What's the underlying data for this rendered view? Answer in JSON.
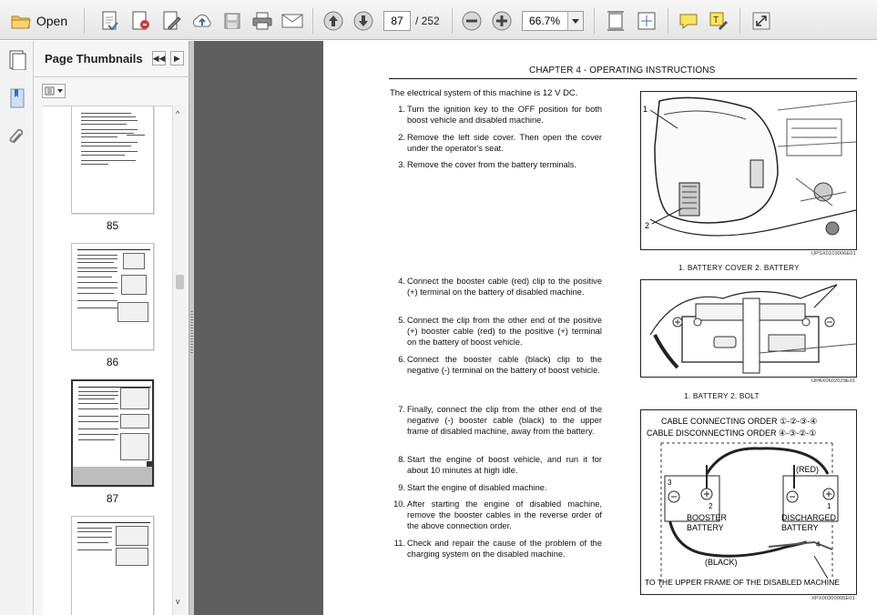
{
  "toolbar": {
    "open_label": "Open",
    "page_current": "87",
    "page_total": "/ 252",
    "zoom": "66.7%"
  },
  "panel": {
    "title": "Page Thumbnails",
    "thumbnails": [
      {
        "label": "85"
      },
      {
        "label": "86"
      },
      {
        "label": "87"
      },
      {
        "label": ""
      }
    ]
  },
  "page": {
    "chapter_header": "CHAPTER 4 - OPERATING INSTRUCTIONS",
    "intro": "The electrical system of this machine is 12 V DC.",
    "steps": [
      {
        "num": "1.",
        "text": "Turn the ignition key to the OFF position for both boost vehicle and disabled machine."
      },
      {
        "num": "2.",
        "text": "Remove the left side cover. Then open the cover under the operator's seat."
      },
      {
        "num": "3.",
        "text": "Remove the cover from the battery terminals."
      },
      {
        "num": "4.",
        "text": "Connect the booster cable (red) clip to the positive (+) terminal on the battery of disabled machine."
      },
      {
        "num": "5.",
        "text": "Connect the clip from the other end of the positive (+) booster cable (red) to the positive (+) terminal on the battery of boost vehicle."
      },
      {
        "num": "6.",
        "text": "Connect the booster cable (black) clip to the negative (-) terminal on the battery of boost vehicle."
      },
      {
        "num": "7.",
        "text": "Finally, connect the clip from the other end of the negative (-) booster cable (black) to the upper frame of disabled machine, away from the battery."
      },
      {
        "num": "8.",
        "text": "Start the engine of boost vehicle, and run it for about 10 minutes at high idle."
      },
      {
        "num": "9.",
        "text": "Start the engine of disabled machine."
      },
      {
        "num": "10.",
        "text": "After starting the engine of disabled machine, remove the booster cables in the reverse order of the above connection order."
      },
      {
        "num": "11.",
        "text": "Check and repair the cause of the problem of the charging system on the disabled machine."
      }
    ],
    "fig1": {
      "callout1": "1",
      "callout2": "2",
      "code": "UPSX0103006E01",
      "caption": "1. BATTERY COVER     2. BATTERY"
    },
    "fig2": {
      "code": "UPAX0602029E01",
      "caption": "1. BATTERY          2. BOLT"
    },
    "fig3": {
      "connect_order": "CABLE CONNECTING ORDER ①-②-③-④",
      "disconnect_order": "CABLE DISCONNECTING ORDER ④-③-②-①",
      "red": "(RED)",
      "black": "(BLACK)",
      "booster": "BOOSTER",
      "booster2": "BATTERY",
      "discharged": "DISCHARGED",
      "discharged2": "BATTERY",
      "n1": "1",
      "n2": "2",
      "n3": "3",
      "n4": "4",
      "frame_label": "TO THE UPPER FRAME OF THE DISABLED MACHINE",
      "code": "XPX00300005E01"
    }
  },
  "colors": {
    "toolbar_bg": "#e9e9e9",
    "doc_bg": "#5f5f5f",
    "accent_icon": "#3a6fb7"
  }
}
